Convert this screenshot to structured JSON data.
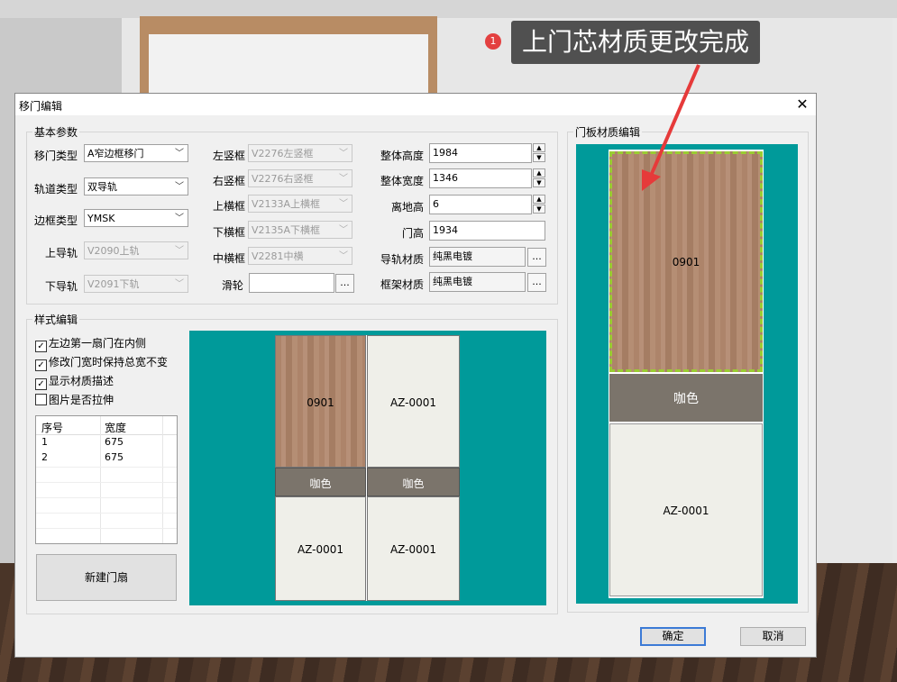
{
  "callout": {
    "badge": "1",
    "text": "上门芯材质更改完成"
  },
  "dialog": {
    "title": "移门编辑",
    "close_glyph": "✕"
  },
  "basic": {
    "title": "基本参数",
    "door_type": {
      "label": "移门类型",
      "value": "A窄边框移门"
    },
    "track_type": {
      "label": "轨道类型",
      "value": "双导轨"
    },
    "frame_type": {
      "label": "边框类型",
      "value": "YMSK"
    },
    "upper_rail": {
      "label": "上导轨",
      "value": "V2090上轨"
    },
    "lower_rail": {
      "label": "下导轨",
      "value": "V2091下轨"
    },
    "left_stile": {
      "label": "左竖框",
      "value": "V2276左竖框"
    },
    "right_stile": {
      "label": "右竖框",
      "value": "V2276右竖框"
    },
    "top_rail": {
      "label": "上横框",
      "value": "V2133A上横框"
    },
    "bottom_rail": {
      "label": "下横框",
      "value": "V2135A下横框"
    },
    "mid_rail": {
      "label": "中横框",
      "value": "V2281中横"
    },
    "pulley": {
      "label": "滑轮",
      "value": ""
    },
    "total_height": {
      "label": "整体高度",
      "value": "1984"
    },
    "total_width": {
      "label": "整体宽度",
      "value": "1346"
    },
    "ground_height": {
      "label": "离地高",
      "value": "6"
    },
    "door_height": {
      "label": "门高",
      "value": "1934"
    },
    "rail_material": {
      "label": "导轨材质",
      "value": "纯黑电镀"
    },
    "frame_material": {
      "label": "框架材质",
      "value": "纯黑电镀"
    },
    "dots": "..."
  },
  "style": {
    "title": "样式编辑",
    "checks": [
      {
        "label": "左边第一扇门在内侧",
        "checked": true
      },
      {
        "label": "修改门宽时保持总宽不变",
        "checked": true
      },
      {
        "label": "显示材质描述",
        "checked": true
      },
      {
        "label": "图片是否拉伸",
        "checked": false
      }
    ],
    "check_glyph": "✓",
    "grid": {
      "headers": [
        "序号",
        "宽度"
      ],
      "rows": [
        [
          "1",
          "675"
        ],
        [
          "2",
          "675"
        ]
      ]
    },
    "new_door_button": "新建门扇",
    "preview": {
      "doors": [
        {
          "top": "0901",
          "mid": "咖色",
          "bottom": "AZ-0001"
        },
        {
          "top": "AZ-0001",
          "mid": "咖色",
          "bottom": "AZ-0001"
        }
      ]
    }
  },
  "panel_edit": {
    "title": "门板材质编辑",
    "top": "0901",
    "mid": "咖色",
    "bottom": "AZ-0001"
  },
  "buttons": {
    "ok": "确定",
    "cancel": "取消"
  },
  "colors": {
    "teal": "#009a9a",
    "wood": "#ad846a",
    "coffee": "#7b746b",
    "cream": "#efefe9",
    "selection": "#9acd32"
  }
}
